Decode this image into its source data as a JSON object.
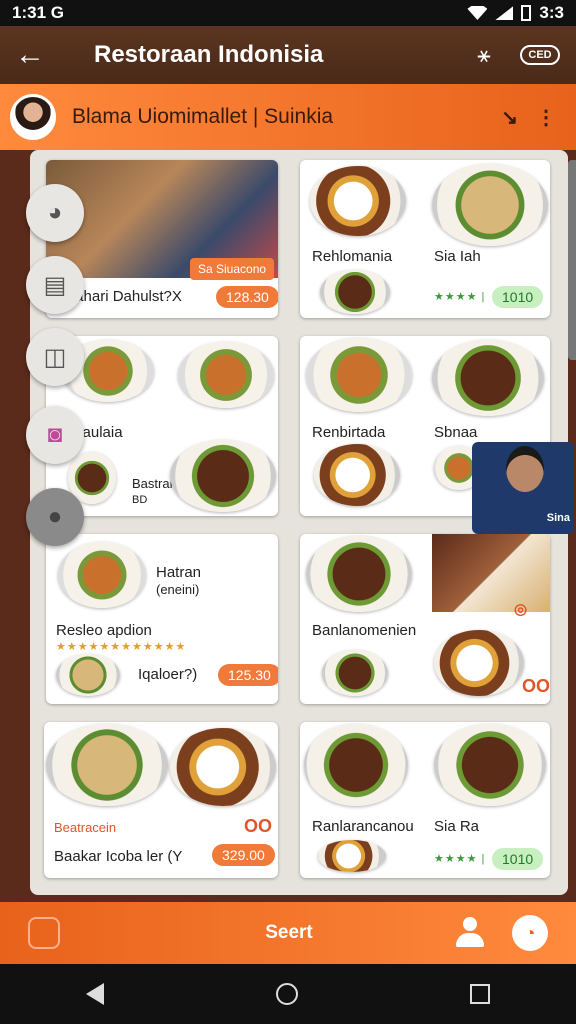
{
  "status": {
    "time": "1:31 G",
    "battery": "3:3"
  },
  "app_bar": {
    "title": "Restoraan Indonisia",
    "badge": "CED"
  },
  "profile": {
    "name": "Blama Uiomimallet | Suinkia"
  },
  "side_fabs": [
    "globe-icon",
    "contacts-icon",
    "book-icon",
    "instagram-icon",
    "person-icon"
  ],
  "cards": {
    "c1": {
      "title": "Daahari Dahulst?X",
      "tag": "Sa Siuacono",
      "price": "128.30"
    },
    "c2": {
      "title_a": "Rehlomania",
      "title_b": "Sia Iah",
      "price": "1010"
    },
    "c3": {
      "title_a": "Nalaulaia",
      "title_b": "Bastran",
      "title_c": "BD"
    },
    "c4": {
      "title_a": "Renbirtada",
      "title_b": "Sbnaa"
    },
    "c5": {
      "title_a": "Hatran",
      "title_b": "(eneini)",
      "title_c": "Resleo apdion",
      "title_d": "Iqaloer?)",
      "price": "125.30"
    },
    "c6": {
      "title_a": "Banlanomenien"
    },
    "c7": {
      "title_a": "Beatracein",
      "title_b": "Baakar Icoba ler (Y",
      "price": "329.00"
    },
    "c8": {
      "title_a": "Ranlarancanou",
      "title_b": "Sia Ra",
      "price": "1010"
    }
  },
  "person_tag": "Sina",
  "bottom_bar": {
    "label": "Seert"
  }
}
